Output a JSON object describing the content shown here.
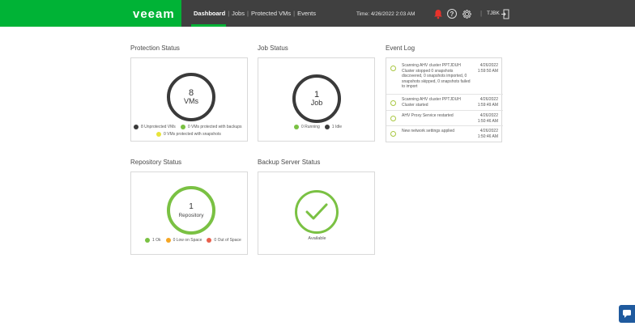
{
  "brand": {
    "name": "veeam"
  },
  "nav": {
    "items": [
      "Dashboard",
      "Jobs",
      "Protected VMs",
      "Events"
    ],
    "active": "Dashboard"
  },
  "header": {
    "time": "Time: 4/26/2022 2:03 AM",
    "user": "TJBK"
  },
  "protection_status": {
    "title": "Protection Status",
    "value": "8",
    "unit": "VMs",
    "legend": [
      {
        "label": "8 Unprotected VMs",
        "color": "#3a3a3a"
      },
      {
        "label": "0 VMs protected with backups",
        "color": "#7ac143"
      },
      {
        "label": "0 VMs protected with snapshots",
        "color": "#e8e43a"
      }
    ]
  },
  "job_status": {
    "title": "Job Status",
    "value": "1",
    "unit": "Job",
    "legend": [
      {
        "label": "0 Running",
        "color": "#7ac143"
      },
      {
        "label": "1 Idle",
        "color": "#3a3a3a"
      }
    ]
  },
  "event_log": {
    "title": "Event Log",
    "events": [
      {
        "text": "Scanning AHV cluster PPTJDUH Cluster stopped 0 snapshots discovered, 0 snapshots imported, 0 snapshots skipped, 0 snapshots failed to import",
        "date": "4/26/2022",
        "time": "1:59:50 AM"
      },
      {
        "text": "Scanning AHV cluster PPTJDUH Cluster started",
        "date": "4/26/2022",
        "time": "1:59:49 AM"
      },
      {
        "text": "AHV Proxy Service restarted",
        "date": "4/26/2022",
        "time": "1:50:46 AM"
      },
      {
        "text": "New network settings applied",
        "date": "4/26/2022",
        "time": "1:50:46 AM"
      }
    ]
  },
  "repository_status": {
    "title": "Repository Status",
    "value": "1",
    "unit": "Repository",
    "legend": [
      {
        "label": "1 Ok",
        "color": "#7ac143"
      },
      {
        "label": "0 Low on Space",
        "color": "#f5a623"
      },
      {
        "label": "0 Out of Space",
        "color": "#e8604c"
      }
    ]
  },
  "backup_server_status": {
    "title": "Backup Server Status",
    "status": "Available"
  },
  "colors": {
    "brand_green": "#00b336",
    "topbar": "#404040",
    "ring_green": "#7ac143",
    "ring_dark": "#3a3a3a"
  },
  "icons": [
    "bell-icon",
    "help-icon",
    "gear-icon",
    "logout-icon",
    "checkmark-icon",
    "chat-icon"
  ]
}
